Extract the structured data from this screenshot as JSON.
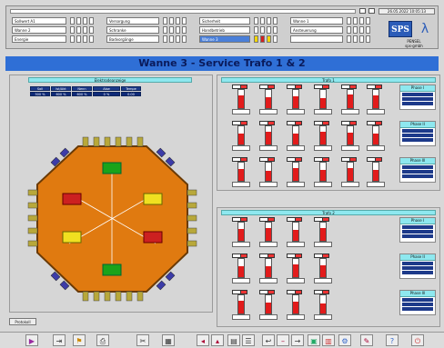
{
  "top": {
    "date": "26.05.2022 10:05:13",
    "rows": [
      [
        "Sollwert A1",
        "Versorgung",
        "Sicherheit",
        "Wanne 1"
      ],
      [
        "Wanne 2",
        "Schranke",
        "Handbetrieb",
        "Ansteuerung"
      ],
      [
        "Energie",
        "Badvorgänge",
        "Wanne 3",
        ""
      ]
    ],
    "logo": "SPS",
    "logo_sub": "PENSEL\nsps-gmbh"
  },
  "title": "Wanne 3 - Service Trafo 1 & 2",
  "left": {
    "caption": "Elektrodeanzeige",
    "headers": [
      "Soll",
      "Ist/Akt",
      "Nenn",
      "Abw",
      "Tempe"
    ],
    "values": [
      "500 %",
      "600 %",
      "600 %",
      "0 %",
      "0.00"
    ]
  },
  "trafo1": {
    "caption": "Trafo 1",
    "phases": [
      "Phase I",
      "Phase II",
      "Phase III"
    ]
  },
  "trafo2": {
    "caption": "Trafo 2",
    "phases": [
      "Phase I",
      "Phase II",
      "Phase III"
    ]
  },
  "protocol_label": "Protokoll"
}
